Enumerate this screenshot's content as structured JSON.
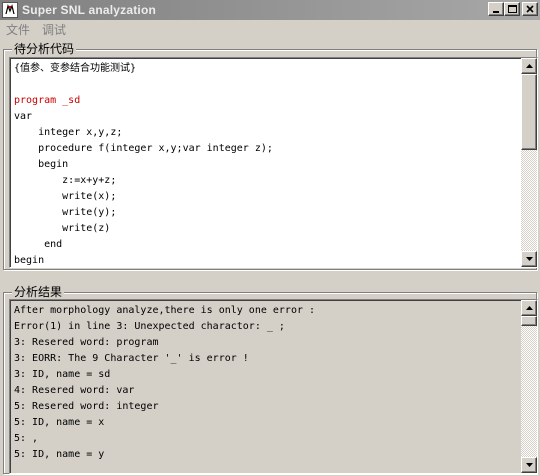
{
  "window": {
    "title": "Super SNL analyzation",
    "icon": "app-icon",
    "controls": [
      "minimize-icon",
      "maximize-icon",
      "close-icon"
    ]
  },
  "menu": {
    "items": [
      {
        "label": "文件"
      },
      {
        "label": "调试"
      }
    ]
  },
  "code_panel": {
    "title": "待分析代码",
    "lines": [
      {
        "text": "{值参、变参结合功能测试}",
        "color": "#000000"
      },
      {
        "text": "",
        "color": "#000000"
      },
      {
        "text": "program _sd",
        "color": "#cc0000"
      },
      {
        "text": "var",
        "color": "#000000"
      },
      {
        "text": "    integer x,y,z;",
        "color": "#000000"
      },
      {
        "text": "    procedure f(integer x,y;var integer z);",
        "color": "#000000"
      },
      {
        "text": "    begin",
        "color": "#000000"
      },
      {
        "text": "        z:=x+y+z;",
        "color": "#000000"
      },
      {
        "text": "        write(x);",
        "color": "#000000"
      },
      {
        "text": "        write(y);",
        "color": "#000000"
      },
      {
        "text": "        write(z)",
        "color": "#000000"
      },
      {
        "text": "     end",
        "color": "#000000"
      },
      {
        "text": "begin",
        "color": "#000000"
      }
    ]
  },
  "result_panel": {
    "title": "分析结果",
    "lines": [
      {
        "text": "After morphology analyze,there is only one error :"
      },
      {
        "text": "Error(1) in line 3: Unexpected charactor: _ ;"
      },
      {
        "text": "3: Resered word: program"
      },
      {
        "text": "3: EORR: The 9 Character '_' is error !"
      },
      {
        "text": "3: ID, name = sd"
      },
      {
        "text": "4: Resered word: var"
      },
      {
        "text": "5: Resered word: integer"
      },
      {
        "text": "5: ID, name = x"
      },
      {
        "text": "5: ,"
      },
      {
        "text": "5: ID, name = y"
      }
    ]
  },
  "colors": {
    "window_bg": "#d4d0c8",
    "titlebar_inactive": "#808080",
    "keyword_red": "#cc0000"
  }
}
